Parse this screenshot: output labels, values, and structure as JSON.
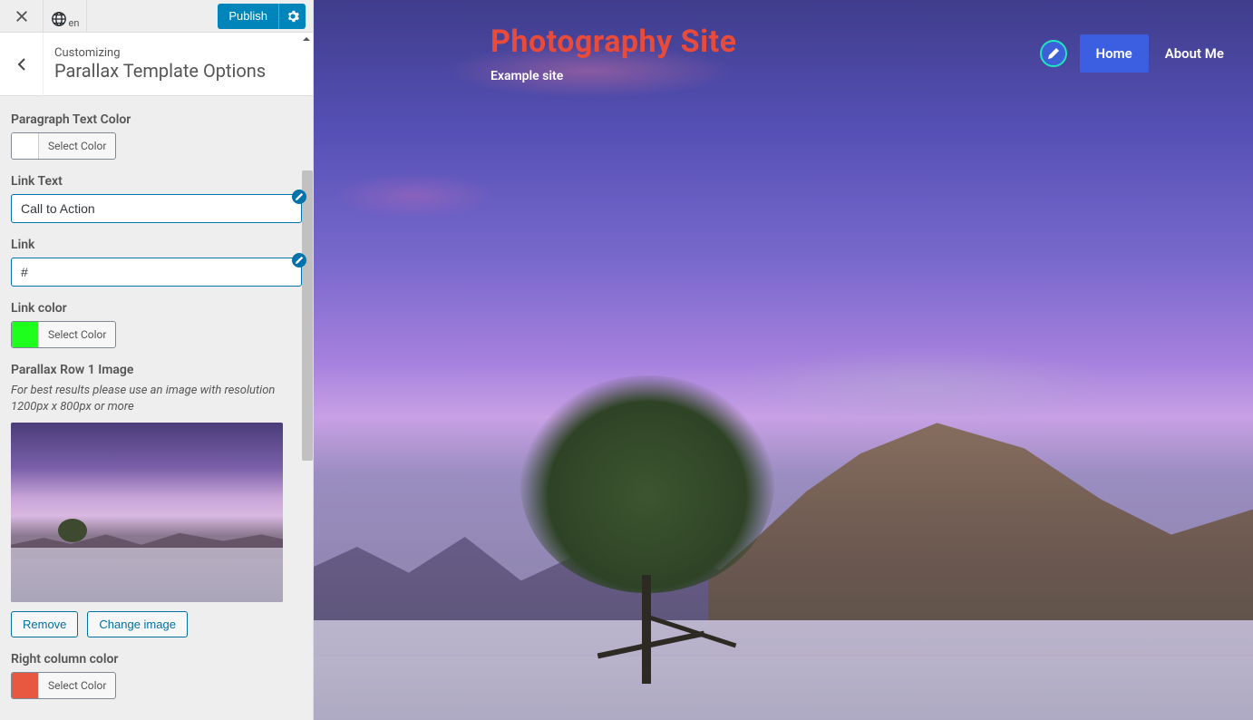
{
  "toolbar": {
    "lang": "en",
    "publish": "Publish"
  },
  "panel": {
    "pre": "Customizing",
    "title": "Parallax Template Options"
  },
  "fields": {
    "para_color_label": "Paragraph Text Color",
    "select_color": "Select Color",
    "link_text_label": "Link Text",
    "link_text_value": "Call to Action",
    "link_label": "Link",
    "link_value": "#",
    "link_color_label": "Link color",
    "image_label": "Parallax Row 1 Image",
    "image_help": "For best results please use an image with resolution 1200px x 800px or more",
    "remove": "Remove",
    "change": "Change image",
    "right_col_label": "Right column color"
  },
  "colors": {
    "para": "#ffffff",
    "link": "#1eff1e",
    "right": "#e8573f"
  },
  "preview": {
    "site_title": "Photography Site",
    "tagline": "Example site",
    "nav_home": "Home",
    "nav_about": "About Me"
  }
}
